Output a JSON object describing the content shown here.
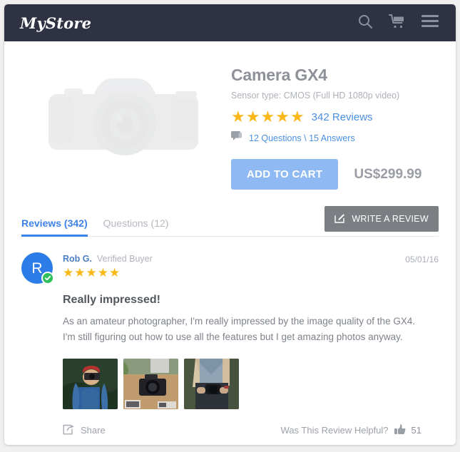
{
  "header": {
    "logo": "MyStore",
    "icons": [
      {
        "name": "search-icon",
        "label": "Search"
      },
      {
        "name": "cart-icon",
        "label": "Cart"
      },
      {
        "name": "menu-icon",
        "label": "Menu"
      }
    ]
  },
  "product": {
    "image_alt": "Camera GX4 DSLR product photo",
    "title": "Camera GX4",
    "subtitle": "Sensor type: CMOS (Full HD 1080p video)",
    "star_count": 5,
    "star_glyph": "★",
    "reviews_link": "342 Reviews",
    "qa_link": "12 Questions \\ 15 Answers",
    "add_to_cart_label": "ADD TO CART",
    "price": "US$299.99"
  },
  "tabs": [
    {
      "label": "Reviews (342)",
      "active": true
    },
    {
      "label": "Questions (12)",
      "active": false
    }
  ],
  "write_review_label": "WRITE A REVIEW",
  "review": {
    "avatar_initial": "R",
    "reviewer_name": "Rob G.",
    "verified_label": "Verified Buyer",
    "date": "05/01/16",
    "star_count": 5,
    "star_glyph": "★",
    "title": "Really impressed!",
    "body": "As an amateur photographer, I'm really impressed by the image quality of the GX4. I'm still figuring out how to use all the features but I get amazing photos anyway.",
    "photos": [
      {
        "alt": "Woman in red beanie taking a photo"
      },
      {
        "alt": "Black DSLR camera on wooden table"
      },
      {
        "alt": "Person holding a camera, denim shirt"
      }
    ],
    "share_label": "Share",
    "helpful_question": "Was This Review Helpful?",
    "helpful_count": "51"
  },
  "colors": {
    "header_bg": "#2e3243",
    "accent_blue": "#3c82e8",
    "link_blue": "#4b90e2",
    "star_gold": "#f9b817",
    "cart_button": "#8fb9f2",
    "verified_green": "#2fbf5c",
    "avatar_blue": "#2d7ce8",
    "write_review_gray": "#7b7f84"
  }
}
